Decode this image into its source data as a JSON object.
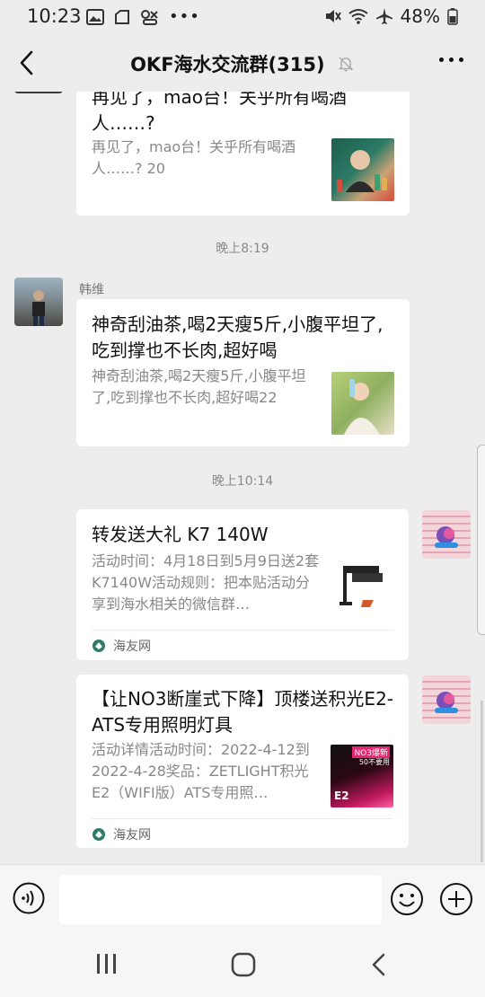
{
  "status": {
    "time": "10:23",
    "battery": "48%"
  },
  "header": {
    "title": "OKF海水交流群(315)"
  },
  "messages": {
    "card1": {
      "title_partial": "再见了，mao台！关乎所有喝酒",
      "title_line2": "人……?",
      "desc": "再见了，mao台！关乎所有喝酒人……? 20"
    },
    "time1": "晚上8:19",
    "card2": {
      "sender": "韩维",
      "title": "神奇刮油茶,喝2天瘦5斤,小腹平坦了,吃到撑也不长肉,超好喝",
      "desc": "神奇刮油茶,喝2天瘦5斤,小腹平坦了,吃到撑也不长肉,超好喝22"
    },
    "time2": "晚上10:14",
    "card3": {
      "title": "转发送大礼 K7 140W",
      "desc": "活动时间：4月18日到5月9日送2套K7140W活动规则：把本贴活动分享到海水相关的微信群…",
      "source": "海友网"
    },
    "card4": {
      "title": "【让NO3断崖式下降】顶楼送积光E2-ATS专用照明灯具",
      "desc": "活动详情活动时间：2022-4-12到2022-4-28奖品：ZETLIGHT积光E2（WIFI版）ATS专用照…",
      "source": "海友网",
      "thumb_text_top": "NO3爆新",
      "thumb_text_sub": "50不要用",
      "thumb_text_brand": "E2"
    }
  },
  "icons": {
    "back": "chevron-left-icon",
    "mute": "bell-off-icon",
    "more": "more-dots-icon",
    "voice": "voice-icon",
    "emoji": "emoji-icon",
    "plus": "plus-icon"
  }
}
